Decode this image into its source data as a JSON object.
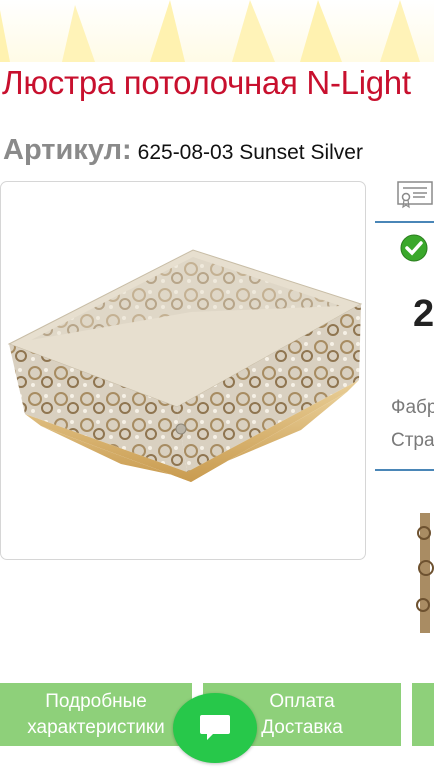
{
  "product": {
    "title": "Люстра потолочная N-Light",
    "article_label": "Артикул:",
    "article_value": "625-08-03 Sunset Silver",
    "photo_alt": "ceiling-chandelier-photo"
  },
  "side_panel": {
    "price_partial": "2",
    "manufacturer_label_partial": "Фабр",
    "country_label_partial": "Стра"
  },
  "tabs": [
    {
      "line1": "Подробные",
      "line2": "характеристики"
    },
    {
      "line1": "Оплата",
      "line2": "Доставка"
    }
  ],
  "icons": {
    "certificate": "certificate-icon",
    "in_stock": "check-circle-icon",
    "chat": "chat-icon"
  },
  "colors": {
    "title": "#c8102e",
    "tab_green": "#8ed07a",
    "chat_green": "#27c84a",
    "rule_blue": "#4a86b7"
  }
}
